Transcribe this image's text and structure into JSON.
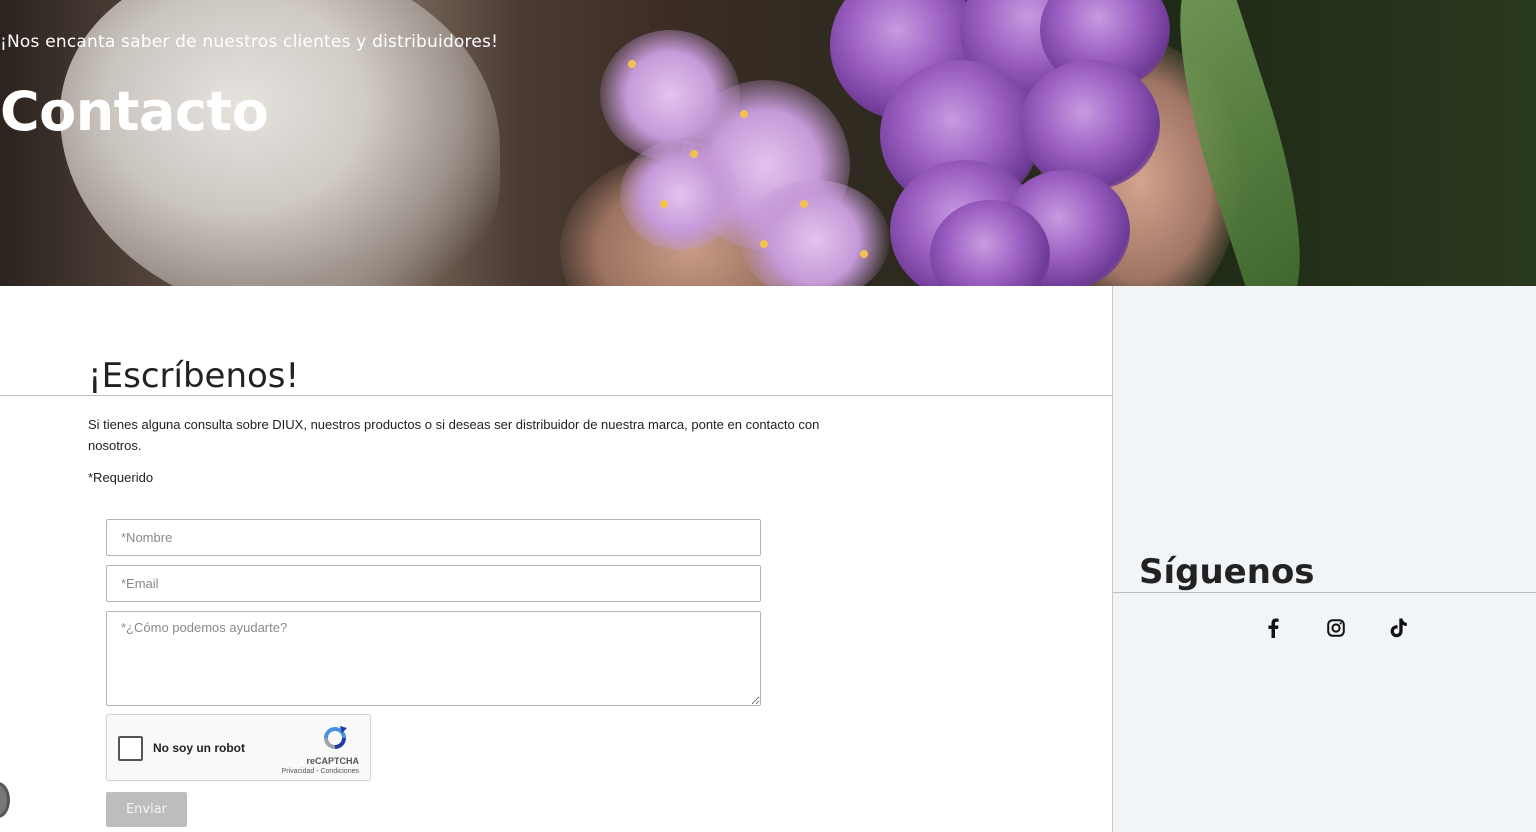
{
  "hero": {
    "subtitle": "¡Nos encanta saber de nuestros clientes y distribuidores!",
    "title": "Contacto"
  },
  "contact": {
    "heading": "¡Escríbenos!",
    "intro": "Si tienes alguna consulta sobre DIUX, nuestros productos o si deseas ser distribuidor de nuestra marca, ponte en contacto con nosotros.",
    "required_note": "*Requerido",
    "fields": {
      "name_placeholder": "*Nombre",
      "email_placeholder": "*Email",
      "message_placeholder": "*¿Cómo podemos ayudarte?"
    },
    "captcha": {
      "label": "No soy un robot",
      "brand": "reCAPTCHA",
      "links": "Privacidad - Condiciones"
    },
    "submit_label": "Enviar"
  },
  "sidebar": {
    "heading": "Síguenos",
    "social_icons": [
      "facebook-icon",
      "instagram-icon",
      "tiktok-icon"
    ]
  },
  "colors": {
    "button_disabled": "#bdbdbd",
    "sidebar_bg": "#f2f5f8",
    "captcha_blue": "#1c3aa9"
  }
}
